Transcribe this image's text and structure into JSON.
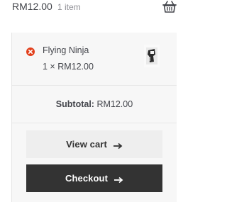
{
  "cart_summary": {
    "amount": "RM12.00",
    "count": "1 item",
    "icon": "basket-icon"
  },
  "cart_item": {
    "name": "Flying Ninja",
    "quantity_price": "1 × RM12.00",
    "remove_icon": "remove-icon",
    "remove_color": "#e2401c"
  },
  "subtotal": {
    "label": "Subtotal:",
    "value": "RM12.00"
  },
  "buttons": {
    "view_cart": "View cart",
    "checkout": "Checkout"
  },
  "colors": {
    "checkout_bg": "#333333",
    "view_cart_bg": "#eeeeee",
    "panel_bg": "#f7f7f7"
  }
}
